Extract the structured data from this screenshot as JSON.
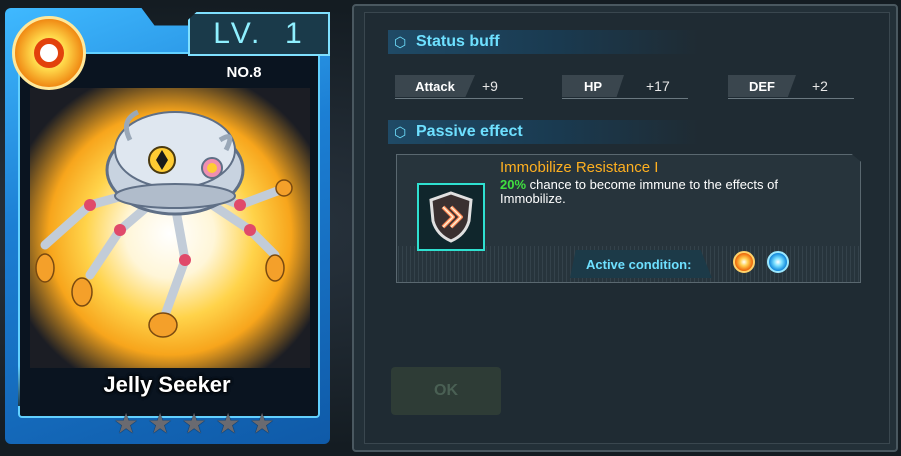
{
  "card": {
    "level": "LV.  1",
    "number": "NO.8",
    "name": "Jelly Seeker",
    "stars": [
      "★",
      "★",
      "★",
      "★",
      "★"
    ],
    "star_color": "#6a6a70",
    "frame_color": "#1c7fd4"
  },
  "status_buff": {
    "title": "Status buff",
    "stats": [
      {
        "label": "Attack",
        "value": "+9"
      },
      {
        "label": "HP",
        "value": "+17"
      },
      {
        "label": "DEF",
        "value": "+2"
      }
    ]
  },
  "passive": {
    "title": "Passive effect",
    "skill_name": "Immobilize Resistance I",
    "skill_percent": "20%",
    "skill_description": " chance to become immune to the effects of Immobilize.",
    "active_condition_label": "Active condition:",
    "condition_icons": [
      "orange-core-icon",
      "blue-core-icon"
    ]
  },
  "ok_label": "OK",
  "colors": {
    "accent": "#6ee0ff",
    "skill_name": "#ffb020",
    "percent": "#40e040"
  }
}
